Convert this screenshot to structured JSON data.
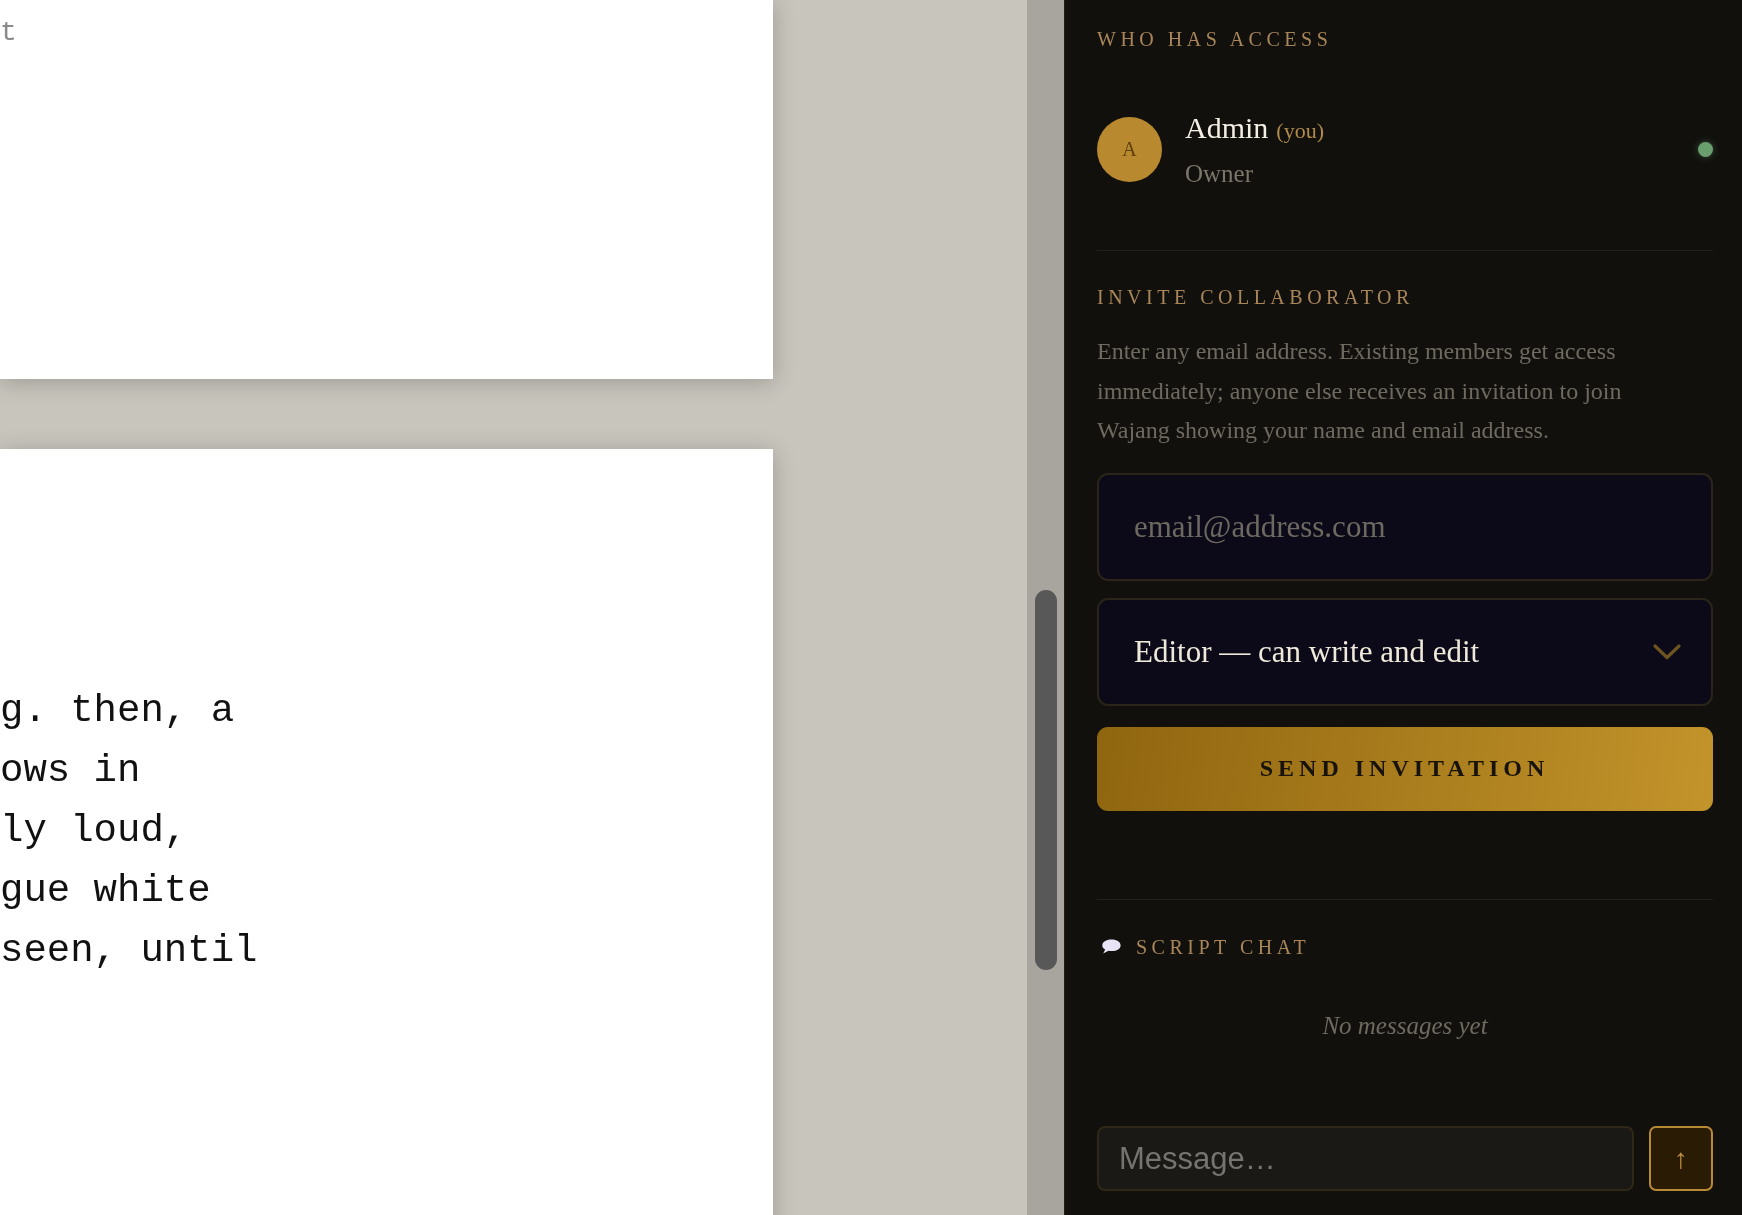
{
  "document": {
    "pages": [
      {
        "kind": "muted",
        "lines": [
          "t"
        ]
      },
      {
        "kind": "body",
        "lines": [
          "g. then, a",
          "ows in",
          "ly loud,",
          "gue white",
          "seen, until"
        ]
      }
    ]
  },
  "access": {
    "title": "WHO HAS ACCESS",
    "members": [
      {
        "initial": "A",
        "name": "Admin",
        "you_label": "(you)",
        "role": "Owner",
        "online": true
      }
    ]
  },
  "invite": {
    "title": "INVITE COLLABORATOR",
    "description": "Enter any email address. Existing members get access immediately; anyone else receives an invitation to join Wajang showing your name and email address.",
    "email": {
      "placeholder": "email@address.com"
    },
    "role_select": {
      "value": "Editor — can write and edit"
    },
    "button": "SEND INVITATION"
  },
  "chat": {
    "title": "SCRIPT CHAT",
    "empty_text": "No messages yet",
    "message": {
      "placeholder": "Message…"
    },
    "send_button": "↑"
  }
}
